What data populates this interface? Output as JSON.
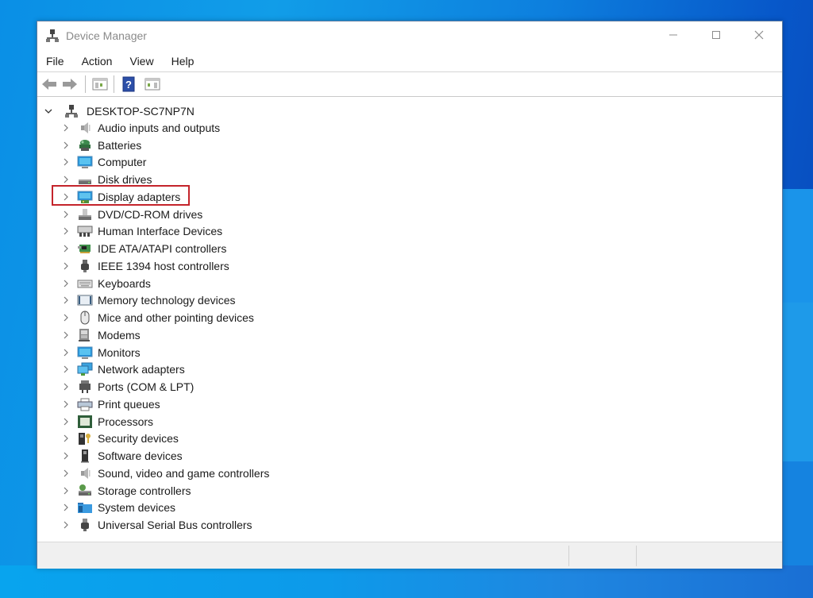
{
  "window": {
    "title": "Device Manager",
    "controls": {
      "minimize": "minimize",
      "maximize": "maximize",
      "close": "close"
    }
  },
  "menubar": {
    "items": [
      "File",
      "Action",
      "View",
      "Help"
    ]
  },
  "toolbar": {
    "buttons": [
      {
        "name": "back",
        "icon": "back-arrow-icon"
      },
      {
        "name": "forward",
        "icon": "forward-arrow-icon"
      },
      {
        "name": "show-hide-console-tree",
        "icon": "console-tree-icon"
      },
      {
        "name": "help",
        "icon": "help-icon"
      },
      {
        "name": "show-hide-action-pane",
        "icon": "action-pane-icon"
      }
    ]
  },
  "tree": {
    "root": {
      "label": "DESKTOP-SC7NP7N",
      "expanded": true,
      "icon": "computer-tower-icon"
    },
    "items": [
      {
        "label": "Audio inputs and outputs",
        "icon": "speaker-icon"
      },
      {
        "label": "Batteries",
        "icon": "battery-icon"
      },
      {
        "label": "Computer",
        "icon": "monitor-icon"
      },
      {
        "label": "Disk drives",
        "icon": "disk-drive-icon"
      },
      {
        "label": "Display adapters",
        "icon": "display-adapter-icon",
        "highlighted": true
      },
      {
        "label": "DVD/CD-ROM drives",
        "icon": "dvd-drive-icon"
      },
      {
        "label": "Human Interface Devices",
        "icon": "hid-icon"
      },
      {
        "label": "IDE ATA/ATAPI controllers",
        "icon": "ide-controller-icon"
      },
      {
        "label": "IEEE 1394 host controllers",
        "icon": "firewire-icon"
      },
      {
        "label": "Keyboards",
        "icon": "keyboard-icon"
      },
      {
        "label": "Memory technology devices",
        "icon": "memory-icon"
      },
      {
        "label": "Mice and other pointing devices",
        "icon": "mouse-icon"
      },
      {
        "label": "Modems",
        "icon": "modem-icon"
      },
      {
        "label": "Monitors",
        "icon": "monitor-icon"
      },
      {
        "label": "Network adapters",
        "icon": "network-icon"
      },
      {
        "label": "Ports (COM & LPT)",
        "icon": "port-icon"
      },
      {
        "label": "Print queues",
        "icon": "printer-icon"
      },
      {
        "label": "Processors",
        "icon": "processor-icon"
      },
      {
        "label": "Security devices",
        "icon": "security-icon"
      },
      {
        "label": "Software devices",
        "icon": "software-device-icon"
      },
      {
        "label": "Sound, video and game controllers",
        "icon": "speaker-icon"
      },
      {
        "label": "Storage controllers",
        "icon": "storage-controller-icon"
      },
      {
        "label": "System devices",
        "icon": "system-folder-icon"
      },
      {
        "label": "Universal Serial Bus controllers",
        "icon": "usb-icon"
      }
    ]
  },
  "colors": {
    "highlight_border": "#c4242b",
    "desktop": "#0d7fde"
  }
}
